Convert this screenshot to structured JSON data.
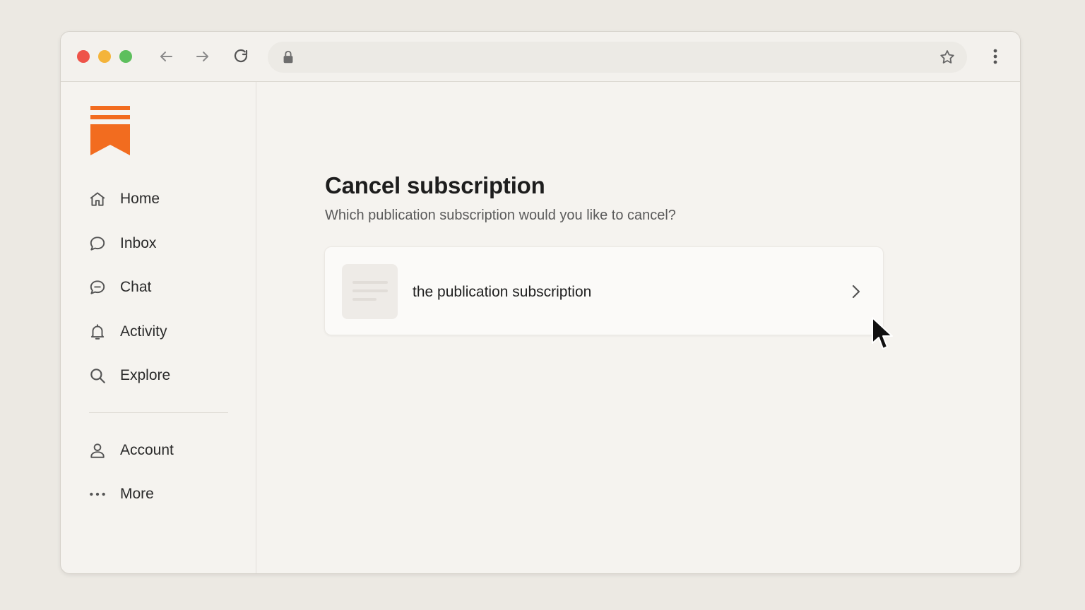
{
  "browser": {
    "url": "",
    "url_placeholder": ""
  },
  "sidebar": {
    "items": [
      {
        "label": "Home",
        "icon": "home-icon"
      },
      {
        "label": "Inbox",
        "icon": "chat-bubble-icon"
      },
      {
        "label": "Chat",
        "icon": "chat-dots-icon"
      },
      {
        "label": "Activity",
        "icon": "bell-icon"
      },
      {
        "label": "Explore",
        "icon": "search-icon"
      }
    ],
    "secondary_items": [
      {
        "label": "Account",
        "icon": "person-icon"
      },
      {
        "label": "More",
        "icon": "ellipsis-icon"
      }
    ]
  },
  "main": {
    "title": "Cancel subscription",
    "subtitle": "Which publication subscription would you like to cancel?",
    "subscriptions": [
      {
        "name": "the publication subscription"
      }
    ]
  },
  "colors": {
    "brand": "#f26c1f",
    "traffic_red": "#ee5349",
    "traffic_yellow": "#f4b43a",
    "traffic_green": "#5dbf5d"
  }
}
